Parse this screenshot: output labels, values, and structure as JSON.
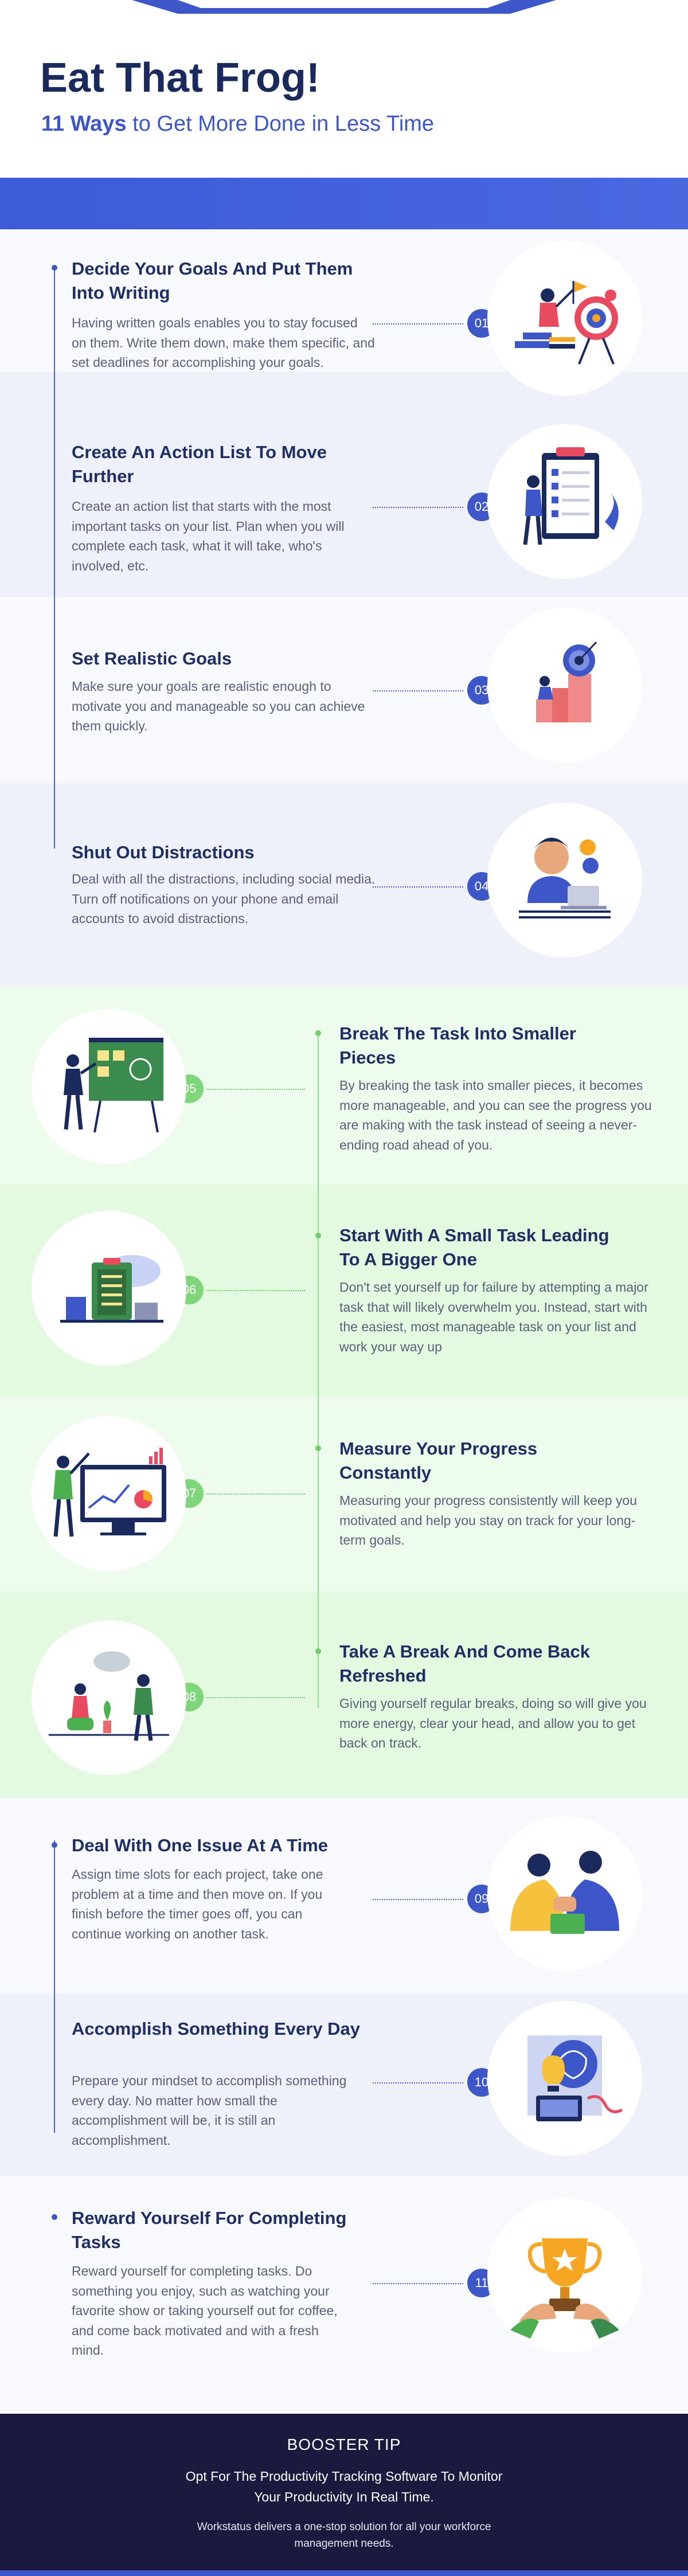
{
  "header": {
    "title": "Eat That Frog!",
    "subtitle_strong": "11 Ways",
    "subtitle_rest": " to Get More Done in Less Time"
  },
  "colors": {
    "navy": "#1b2a5c",
    "accent_blue": "#3d57c9",
    "accent_green": "#7fd67a",
    "footer_bg": "#1a1a3e"
  },
  "tips": [
    {
      "num": "01",
      "title": "Decide Your Goals And Put Them Into Writing",
      "desc": "Having written goals enables you to stay focused on them. Write them down, make them specific, and set deadlines for accomplishing your goals.",
      "icon": "goal-target-icon"
    },
    {
      "num": "02",
      "title": "Create An Action List To Move Further",
      "desc": "Create an action list that starts with the most important tasks on your list. Plan when you will complete each task, what it will take, who's involved, etc.",
      "icon": "checklist-board-icon"
    },
    {
      "num": "03",
      "title": "Set Realistic Goals",
      "desc": "Make sure your goals are realistic enough to motivate you and manageable so you can achieve them quickly.",
      "icon": "climbing-target-icon"
    },
    {
      "num": "04",
      "title": "Shut Out Distractions",
      "desc": "Deal with all the distractions, including social media. Turn off notifications on your phone and email accounts to avoid distractions.",
      "icon": "person-laptop-icon"
    },
    {
      "num": "05",
      "title": "Break The Task Into Smaller Pieces",
      "desc": "By breaking the task into smaller pieces, it becomes more manageable, and you can see the progress you are making with the task instead of seeing a never-ending road ahead of you.",
      "icon": "presentation-board-icon"
    },
    {
      "num": "06",
      "title": "Start With A Small Task Leading To A Bigger One",
      "desc": "Don't set yourself up for failure by attempting a major task that will likely overwhelm you. Instead, start with the easiest, most manageable task on your list and work your way up",
      "icon": "clipboard-cloud-icon"
    },
    {
      "num": "07",
      "title": "Measure Your Progress Constantly",
      "desc": "Measuring your progress consistently will keep you motivated and help you stay on track for your long-term goals.",
      "icon": "analytics-monitor-icon"
    },
    {
      "num": "08",
      "title": "Take A Break And Come Back Refreshed",
      "desc": "Giving yourself regular breaks, doing so will give you more energy, clear your head, and allow you to get back on track.",
      "icon": "people-chatting-icon"
    },
    {
      "num": "09",
      "title": "Deal With One Issue At A Time",
      "desc": "Assign time slots for each project, take one problem at a time and then move on. If you finish before the timer goes off, you can continue working on another task.",
      "icon": "handshake-icon"
    },
    {
      "num": "10",
      "title": "Accomplish Something Every Day",
      "desc": "Prepare your mindset to accomplish something every day. No matter how small the accomplishment will be, it is still an accomplishment.",
      "icon": "brain-idea-icon"
    },
    {
      "num": "11",
      "title": "Reward Yourself For Completing Tasks",
      "desc": "Reward yourself for completing tasks. Do something you enjoy, such as watching your favorite show or taking yourself out for coffee, and come back motivated and with a fresh mind.",
      "icon": "trophy-icon"
    }
  ],
  "footer": {
    "heading": "BOOSTER TIP",
    "main": "Opt For The Productivity Tracking Software To Monitor Your Productivity In Real Time.",
    "sub": "Workstatus delivers a one-stop solution for all your workforce management needs."
  }
}
